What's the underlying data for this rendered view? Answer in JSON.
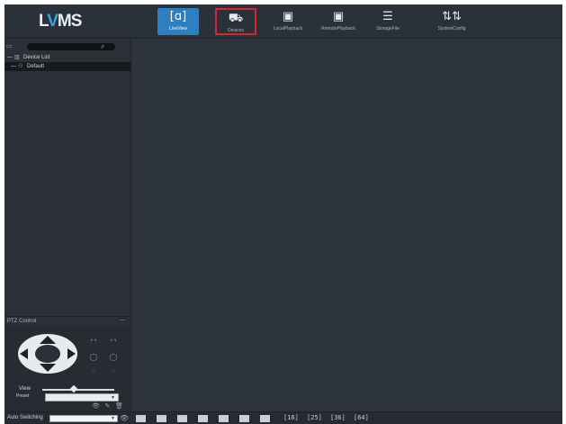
{
  "app": {
    "logo_text_1": "L",
    "logo_text_2": "V",
    "logo_text_3": "MS",
    "accent": "#2e7fbf",
    "highlight": "#d9252f"
  },
  "nav": [
    {
      "label": "LiveView",
      "icon": "liveview-icon",
      "glyph": "[ɑ]",
      "active": true
    },
    {
      "label": "Devices",
      "icon": "camera-icon",
      "glyph": "⛟",
      "highlighted": true
    },
    {
      "label": "LocalPlayback",
      "icon": "film-icon",
      "glyph": "▣"
    },
    {
      "label": "RemotePlayback",
      "icon": "film-remote-icon",
      "glyph": "▣"
    },
    {
      "label": "StorageFile",
      "icon": "storage-icon",
      "glyph": "☰"
    },
    {
      "label": "SystemConfig",
      "icon": "sliders-icon",
      "glyph": "⇅⇅"
    }
  ],
  "sidebar": {
    "search": {
      "value": "",
      "placeholder": ""
    },
    "tree": [
      {
        "label": "Device List",
        "toggle": "—",
        "icon": "device-list-icon",
        "glyph": "▥"
      },
      {
        "label": "Default",
        "toggle": "—",
        "icon": "group-icon",
        "glyph": "⚇"
      }
    ]
  },
  "ptz": {
    "title": "PTZ Control",
    "view_label": "View",
    "preset_label": "Preset",
    "preset_value": ""
  },
  "bottombar": {
    "auto_switching_label": "Auto Switching",
    "auto_switching_value": "",
    "layouts_text": [
      "[16]",
      "[25]",
      "[36]",
      "[64]"
    ]
  }
}
